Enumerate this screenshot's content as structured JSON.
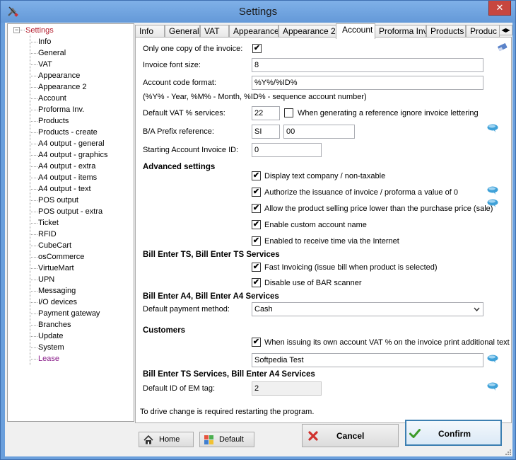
{
  "window": {
    "title": "Settings",
    "close_glyph": "✕",
    "icon": "tools-icon"
  },
  "tree": {
    "root": "Settings",
    "expander_glyph": "−",
    "items": [
      "Info",
      "General",
      "VAT",
      "Appearance",
      "Appearance 2",
      "Account",
      "Proforma Inv.",
      "Products",
      "Products - create",
      "A4 output - general",
      "A4 output - graphics",
      "A4 output - extra",
      "A4 output - items",
      "A4 output - text",
      "POS output",
      "POS output - extra",
      "Ticket",
      "RFID",
      "CubeCart",
      "osCommerce",
      "VirtueMart",
      "UPN",
      "Messaging",
      "I/O devices",
      "Payment gateway",
      "Branches",
      "Update",
      "System",
      "Lease"
    ]
  },
  "tabs": [
    "Info",
    "General",
    "VAT",
    "Appearance",
    "Appearance 2",
    "Account",
    "Proforma Inv.",
    "Products",
    "Produc"
  ],
  "tab_scroll": {
    "left": "◀",
    "right": "▶"
  },
  "form": {
    "only_one_copy_label": "Only one copy of the invoice:",
    "only_one_copy_checked": true,
    "invoice_font_size_label": "Invoice font size:",
    "invoice_font_size_value": "8",
    "account_code_format_label": "Account code format:",
    "account_code_format_value": "%Y%/%ID%",
    "account_code_hint": "(%Y% - Year, %M% - Month, %ID% - sequence account number)",
    "default_vat_label": "Default VAT % services:",
    "default_vat_value": "22",
    "ignore_lettering_label": "When generating a reference ignore invoice lettering",
    "ignore_lettering_checked": false,
    "prefix_label": "B/A Prefix reference:",
    "prefix_value_1": "SI",
    "prefix_value_2": "00",
    "starting_id_label": "Starting Account Invoice ID:",
    "starting_id_value": "0"
  },
  "advanced": {
    "heading": "Advanced settings",
    "options": [
      {
        "label": "Display text company / non-taxable",
        "checked": true
      },
      {
        "label": "Authorize the issuance of invoice / proforma a value of 0",
        "checked": true
      },
      {
        "label": "Allow the product selling price lower than the purchase price (sale)",
        "checked": true
      },
      {
        "label": "Enable custom account name",
        "checked": true
      },
      {
        "label": "Enabled to receive time via the Internet",
        "checked": true
      }
    ]
  },
  "bill_ts": {
    "heading": "Bill Enter TS, Bill Enter TS Services",
    "fast_invoicing_label": "Fast Invoicing (issue bill when product is selected)",
    "fast_invoicing_checked": true,
    "disable_bar_label": "Disable use of BAR scanner",
    "disable_bar_checked": true
  },
  "bill_a4": {
    "heading": "Bill Enter A4, Bill Enter A4 Services",
    "payment_method_label": "Default payment method:",
    "payment_method_value": "Cash"
  },
  "customers": {
    "heading": "Customers",
    "vat_print_label": "When issuing its own account VAT % on the invoice print additional text",
    "vat_print_checked": true,
    "text_value": "Softpedia Test"
  },
  "bill_ts_a4": {
    "heading": "Bill Enter TS Services, Bill Enter A4 Services",
    "em_tag_label": "Default ID of EM tag:",
    "em_tag_value": "2"
  },
  "footer": {
    "restart_note": "To drive change is required restarting the program.",
    "home_label": "Home",
    "default_label": "Default",
    "cancel_label": "Cancel",
    "confirm_label": "Confirm"
  },
  "check_glyph": "✔",
  "colors": {
    "title_bar": "#6a9fdc",
    "tree_selected_root": "#b41f2e",
    "tree_lease": "#8a1e8a",
    "cancel_icon": "#d0312d",
    "confirm_icon": "#3c9b2a",
    "bubble": "#3fa1d8"
  }
}
